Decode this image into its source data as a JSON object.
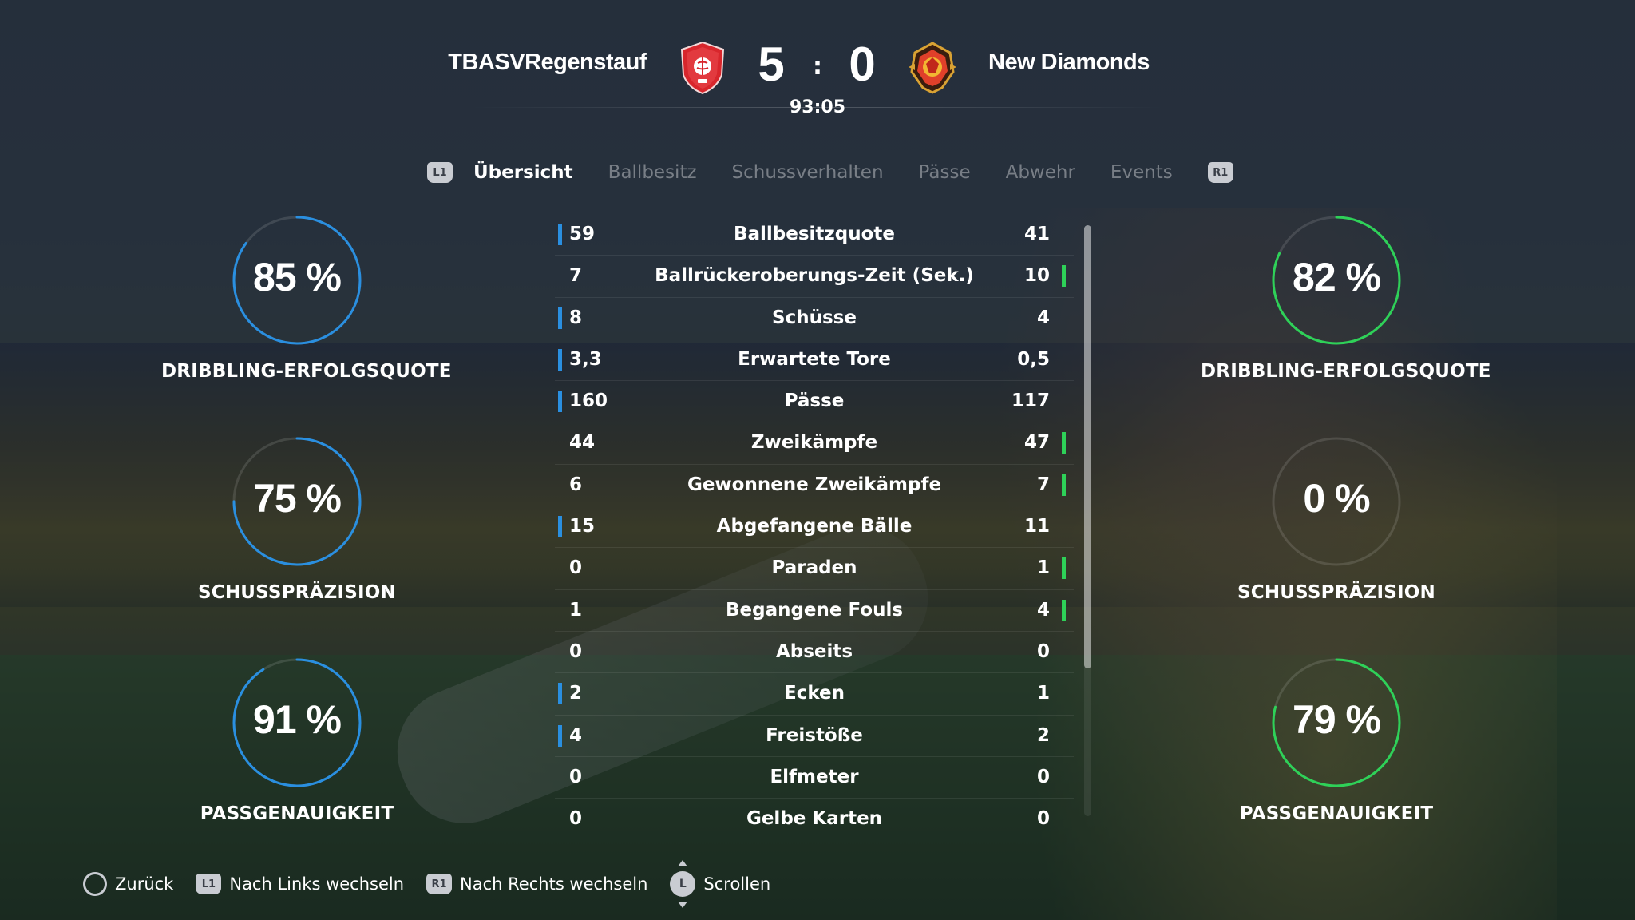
{
  "match": {
    "home_team": "TBASVRegenstauf",
    "away_team": "New Diamonds",
    "home_score": "5",
    "away_score": "0",
    "separator": ":",
    "time": "93:05",
    "home_color": "#2a8fe0",
    "away_color": "#2ed158",
    "home_crest_icon": "shield-crest-icon",
    "away_crest_icon": "gold-crest-icon"
  },
  "tabs": {
    "left_button": "L1",
    "right_button": "R1",
    "items": [
      {
        "label": "Übersicht",
        "active": true
      },
      {
        "label": "Ballbesitz",
        "active": false
      },
      {
        "label": "Schussverhalten",
        "active": false
      },
      {
        "label": "Pässe",
        "active": false
      },
      {
        "label": "Abwehr",
        "active": false
      },
      {
        "label": "Events",
        "active": false
      }
    ]
  },
  "gauges": {
    "home": [
      {
        "value": "85 %",
        "label": "DRIBBLING-ERFOLGSQUOTE",
        "percent": 85
      },
      {
        "value": "75 %",
        "label": "SCHUSSPRÄZISION",
        "percent": 75
      },
      {
        "value": "91 %",
        "label": "PASSGENAUIGKEIT",
        "percent": 91
      }
    ],
    "away": [
      {
        "value": "82 %",
        "label": "DRIBBLING-ERFOLGSQUOTE",
        "percent": 82
      },
      {
        "value": "0 %",
        "label": "SCHUSSPRÄZISION",
        "percent": 0
      },
      {
        "value": "79 %",
        "label": "PASSGENAUIGKEIT",
        "percent": 79
      }
    ]
  },
  "stats": [
    {
      "name": "Ballbesitzquote",
      "home": "59",
      "away": "41",
      "leader": "home"
    },
    {
      "name": "Ballrückeroberungs-Zeit (Sek.)",
      "home": "7",
      "away": "10",
      "leader": "away"
    },
    {
      "name": "Schüsse",
      "home": "8",
      "away": "4",
      "leader": "home"
    },
    {
      "name": "Erwartete Tore",
      "home": "3,3",
      "away": "0,5",
      "leader": "home"
    },
    {
      "name": "Pässe",
      "home": "160",
      "away": "117",
      "leader": "home"
    },
    {
      "name": "Zweikämpfe",
      "home": "44",
      "away": "47",
      "leader": "away"
    },
    {
      "name": "Gewonnene Zweikämpfe",
      "home": "6",
      "away": "7",
      "leader": "away"
    },
    {
      "name": "Abgefangene Bälle",
      "home": "15",
      "away": "11",
      "leader": "home"
    },
    {
      "name": "Paraden",
      "home": "0",
      "away": "1",
      "leader": "away"
    },
    {
      "name": "Begangene Fouls",
      "home": "1",
      "away": "4",
      "leader": "away"
    },
    {
      "name": "Abseits",
      "home": "0",
      "away": "0",
      "leader": "none"
    },
    {
      "name": "Ecken",
      "home": "2",
      "away": "1",
      "leader": "home"
    },
    {
      "name": "Freistöße",
      "home": "4",
      "away": "2",
      "leader": "home"
    },
    {
      "name": "Elfmeter",
      "home": "0",
      "away": "0",
      "leader": "none"
    },
    {
      "name": "Gelbe Karten",
      "home": "0",
      "away": "0",
      "leader": "none"
    }
  ],
  "footer": {
    "back_label": "Zurück",
    "l1_badge": "L1",
    "left_label": "Nach Links wechseln",
    "r1_badge": "R1",
    "right_label": "Nach Rechts wechseln",
    "stick_badge": "L",
    "scroll_label": "Scrollen"
  }
}
